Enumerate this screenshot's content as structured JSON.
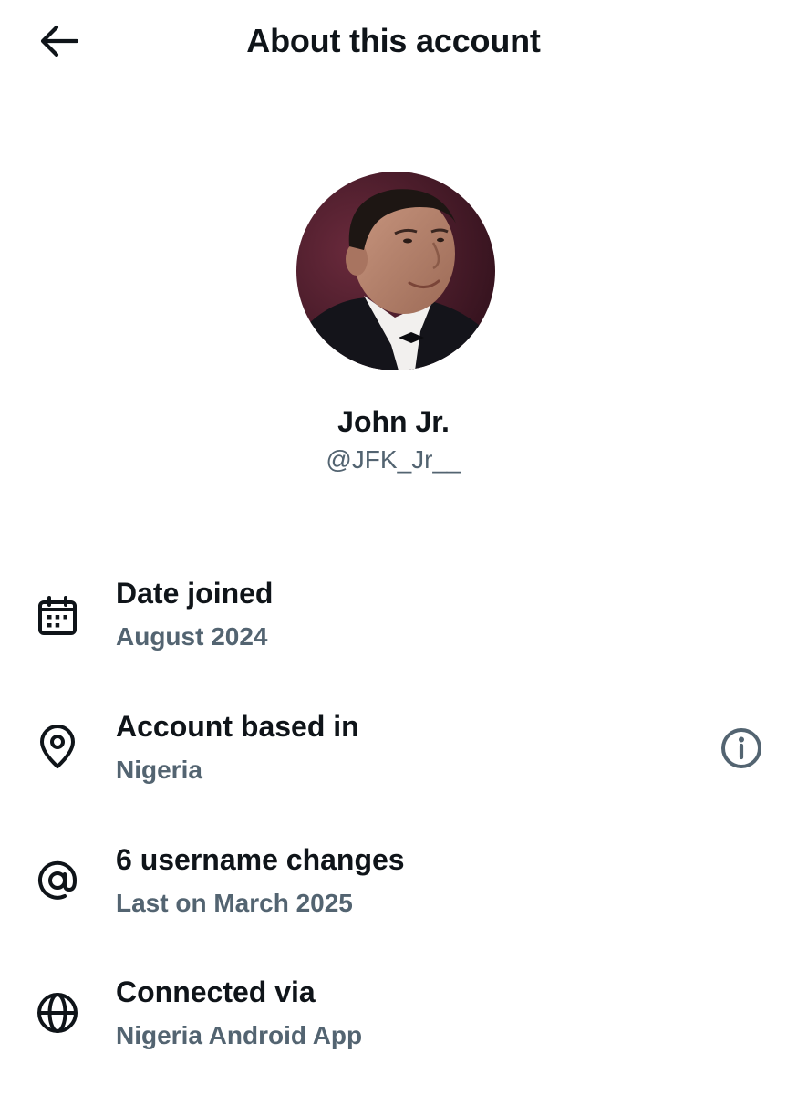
{
  "header": {
    "title": "About this account",
    "back_icon": "arrow-left-icon"
  },
  "profile": {
    "avatar_icon": "profile-photo",
    "name": "John Jr.",
    "handle": "@JFK_Jr__"
  },
  "details": [
    {
      "icon": "calendar-icon",
      "label": "Date joined",
      "value": "August 2024"
    },
    {
      "icon": "location-pin-icon",
      "label": "Account based in",
      "value": "Nigeria",
      "extra_icon": "info-icon"
    },
    {
      "icon": "at-sign-icon",
      "label": "6 username changes",
      "value": "Last on March 2025"
    },
    {
      "icon": "globe-icon",
      "label": "Connected via",
      "value": "Nigeria Android App"
    }
  ],
  "colors": {
    "primary_text": "#0f1419",
    "secondary_text": "#536471",
    "background": "#ffffff"
  }
}
